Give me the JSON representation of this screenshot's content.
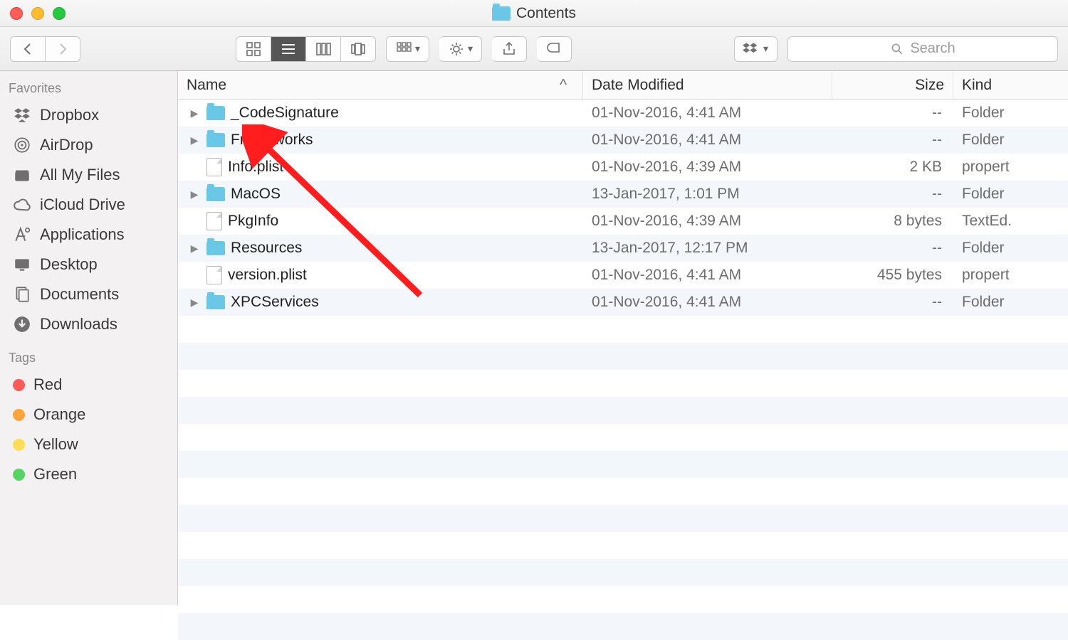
{
  "window": {
    "title": "Contents"
  },
  "toolbar": {
    "search_placeholder": "Search"
  },
  "sidebar": {
    "sections": {
      "favorites_label": "Favorites",
      "tags_label": "Tags"
    },
    "favorites": [
      {
        "label": "Dropbox",
        "icon": "dropbox"
      },
      {
        "label": "AirDrop",
        "icon": "airdrop"
      },
      {
        "label": "All My Files",
        "icon": "all-my-files"
      },
      {
        "label": "iCloud Drive",
        "icon": "icloud"
      },
      {
        "label": "Applications",
        "icon": "applications"
      },
      {
        "label": "Desktop",
        "icon": "desktop"
      },
      {
        "label": "Documents",
        "icon": "documents"
      },
      {
        "label": "Downloads",
        "icon": "downloads"
      }
    ],
    "tags": [
      {
        "label": "Red",
        "color": "#fc5b57"
      },
      {
        "label": "Orange",
        "color": "#fca33b"
      },
      {
        "label": "Yellow",
        "color": "#fdde56"
      },
      {
        "label": "Green",
        "color": "#57d363"
      }
    ]
  },
  "columns": {
    "name": "Name",
    "date_modified": "Date Modified",
    "size": "Size",
    "kind": "Kind"
  },
  "files": [
    {
      "name": "_CodeSignature",
      "is_folder": true,
      "modified": "01-Nov-2016, 4:41 AM",
      "size": "--",
      "kind": "Folder"
    },
    {
      "name": "Frameworks",
      "is_folder": true,
      "modified": "01-Nov-2016, 4:41 AM",
      "size": "--",
      "kind": "Folder"
    },
    {
      "name": "Info.plist",
      "is_folder": false,
      "modified": "01-Nov-2016, 4:39 AM",
      "size": "2 KB",
      "kind": "propert"
    },
    {
      "name": "MacOS",
      "is_folder": true,
      "modified": "13-Jan-2017, 1:01 PM",
      "size": "--",
      "kind": "Folder"
    },
    {
      "name": "PkgInfo",
      "is_folder": false,
      "modified": "01-Nov-2016, 4:39 AM",
      "size": "8 bytes",
      "kind": "TextEd."
    },
    {
      "name": "Resources",
      "is_folder": true,
      "modified": "13-Jan-2017, 12:17 PM",
      "size": "--",
      "kind": "Folder"
    },
    {
      "name": "version.plist",
      "is_folder": false,
      "modified": "01-Nov-2016, 4:41 AM",
      "size": "455 bytes",
      "kind": "propert"
    },
    {
      "name": "XPCServices",
      "is_folder": true,
      "modified": "01-Nov-2016, 4:41 AM",
      "size": "--",
      "kind": "Folder"
    }
  ]
}
